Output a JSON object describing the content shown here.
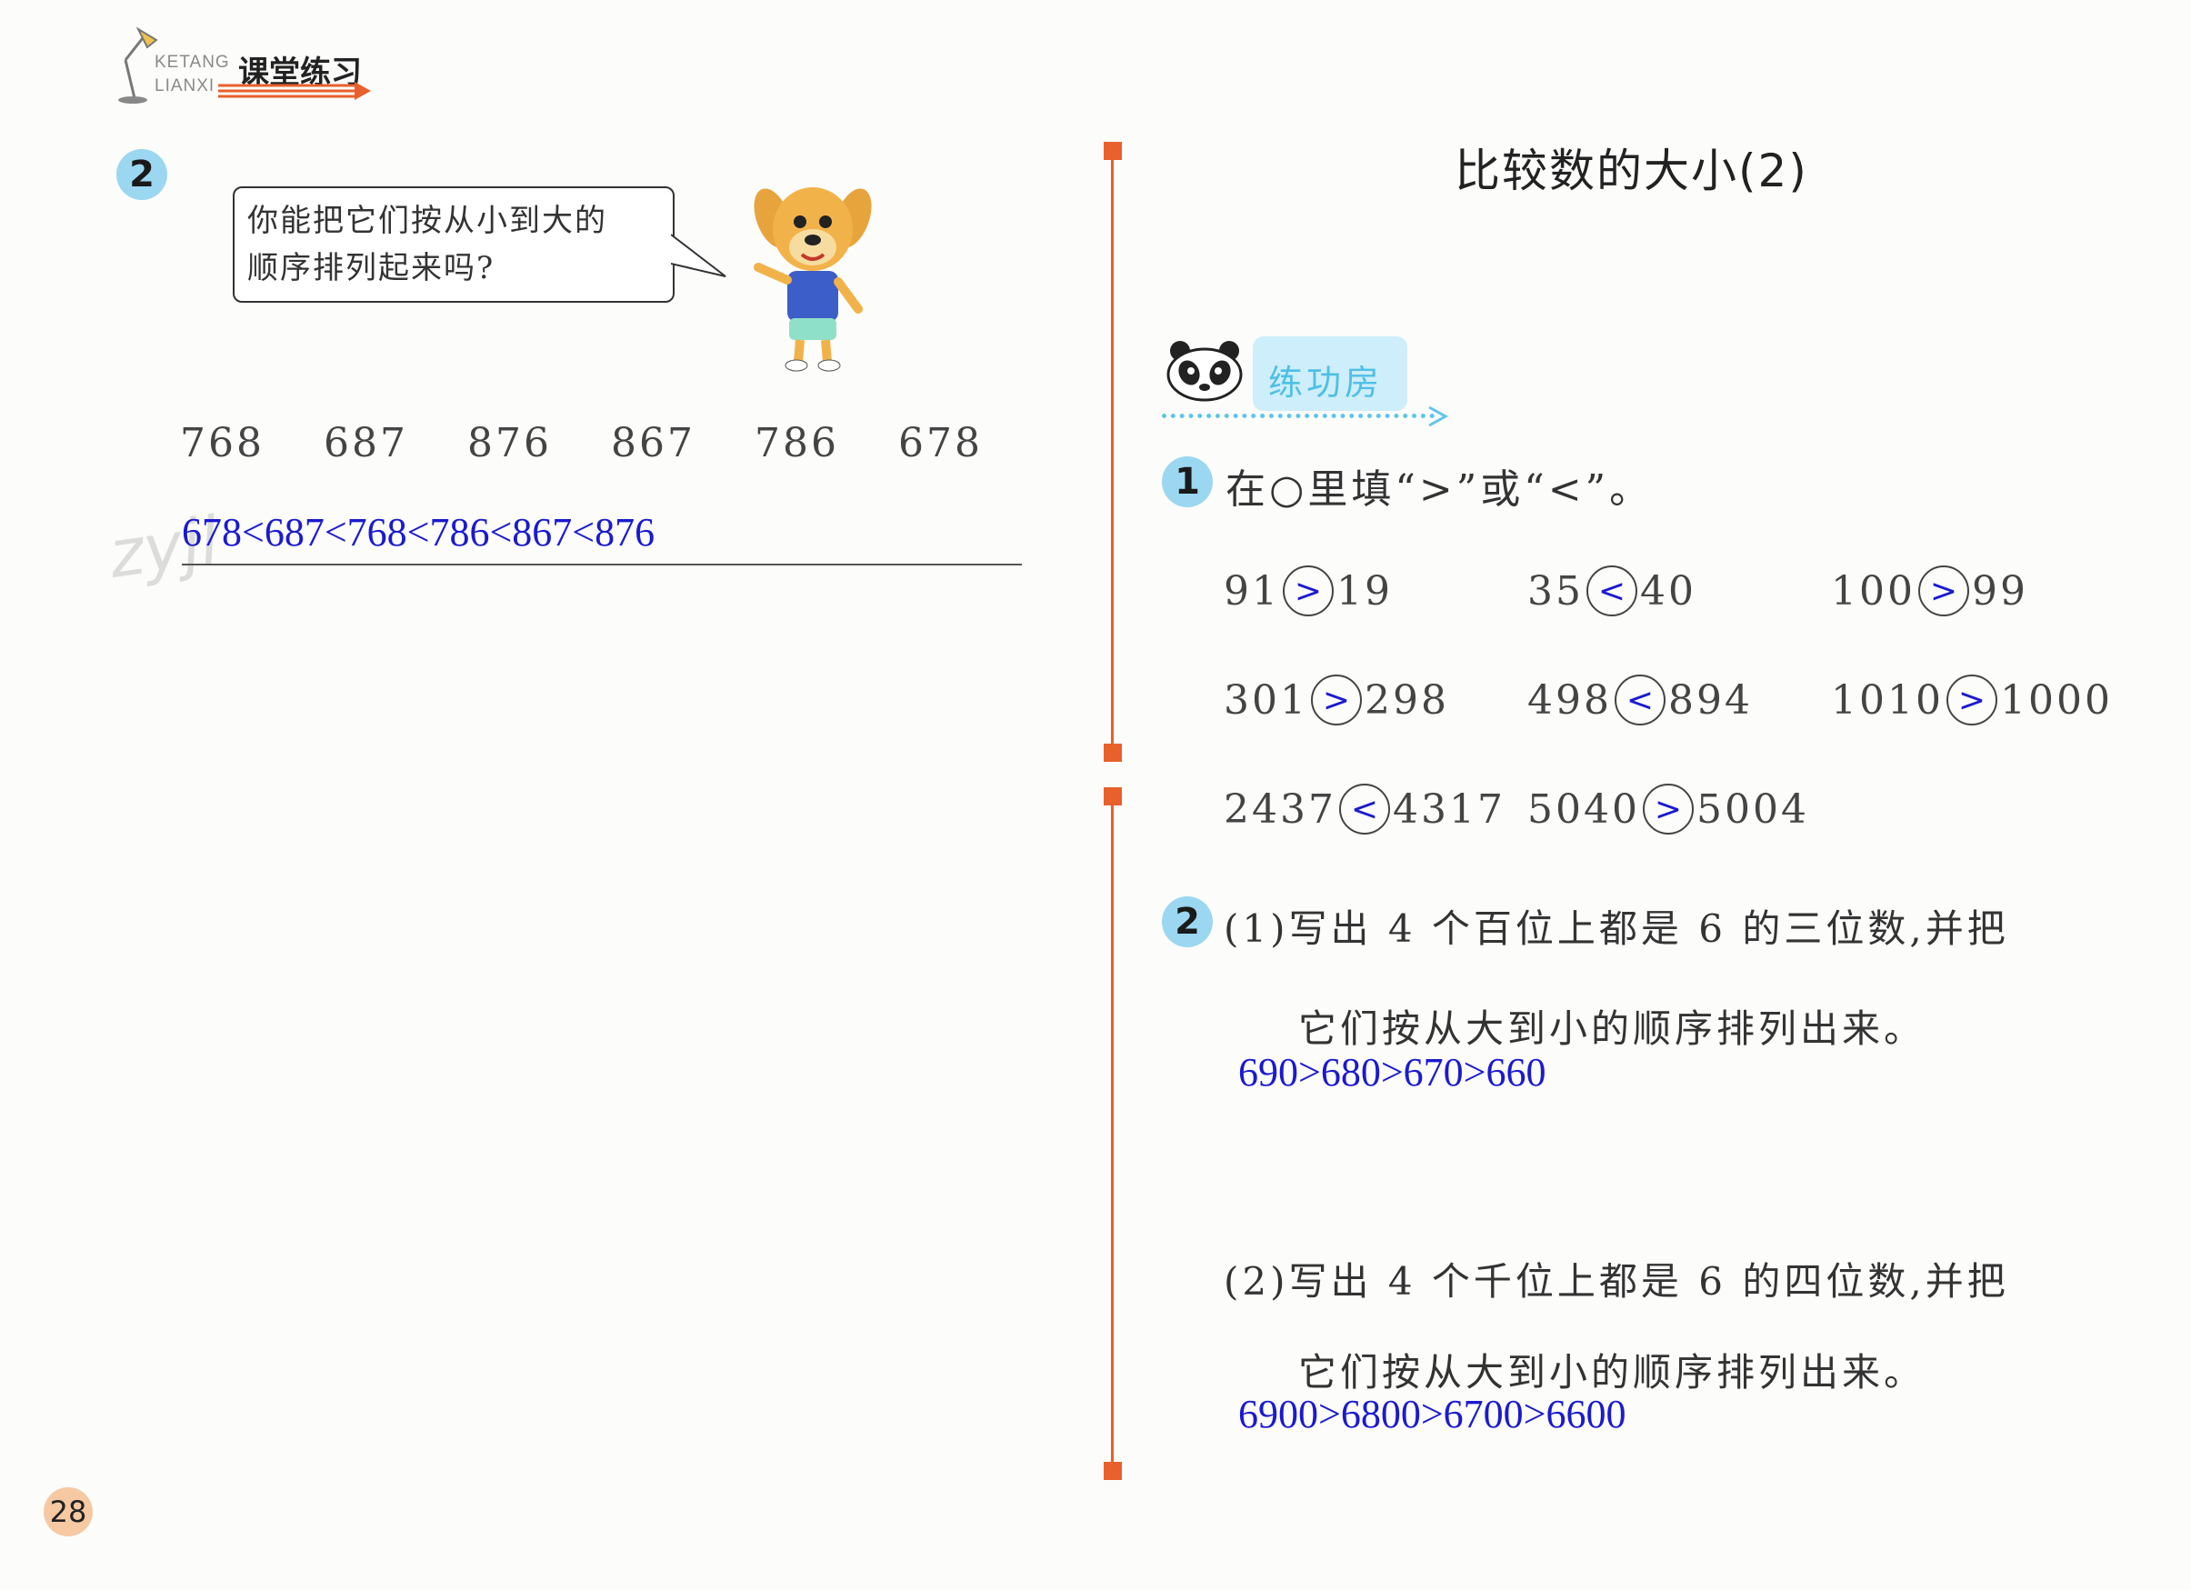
{
  "header": {
    "logo_en_1": "KETANG",
    "logo_en_2": "LIANXI",
    "logo_cn": "课堂练习"
  },
  "left": {
    "badge": "2",
    "speech_line1": "你能把它们按从小到大的",
    "speech_line2": "顺序排列起来吗?",
    "numbers": [
      "768",
      "687",
      "876",
      "867",
      "786",
      "678"
    ],
    "answer": "678<687<768<786<867<876",
    "watermark": "zyjl"
  },
  "right": {
    "title": "比较数的大小(2)",
    "section_label": "练功房",
    "q1": {
      "badge": "1",
      "prompt": "在○里填“>”或“<”。",
      "items": [
        {
          "a": "91",
          "op": ">",
          "b": "19"
        },
        {
          "a": "35",
          "op": "<",
          "b": "40"
        },
        {
          "a": "100",
          "op": ">",
          "b": "99"
        },
        {
          "a": "301",
          "op": ">",
          "b": "298"
        },
        {
          "a": "498",
          "op": "<",
          "b": "894"
        },
        {
          "a": "1010",
          "op": ">",
          "b": "1000"
        },
        {
          "a": "2437",
          "op": "<",
          "b": "4317"
        },
        {
          "a": "5040",
          "op": ">",
          "b": "5004"
        }
      ]
    },
    "q2": {
      "badge": "2",
      "part1_line1": "(1)写出 4 个百位上都是 6 的三位数,并把",
      "part1_line2": "它们按从大到小的顺序排列出来。",
      "part1_answer": "690>680>670>660",
      "part2_line1": "(2)写出 4 个千位上都是 6 的四位数,并把",
      "part2_line2": "它们按从大到小的顺序排列出来。",
      "part2_answer": "6900>6800>6700>6600"
    }
  },
  "page_number": "28"
}
